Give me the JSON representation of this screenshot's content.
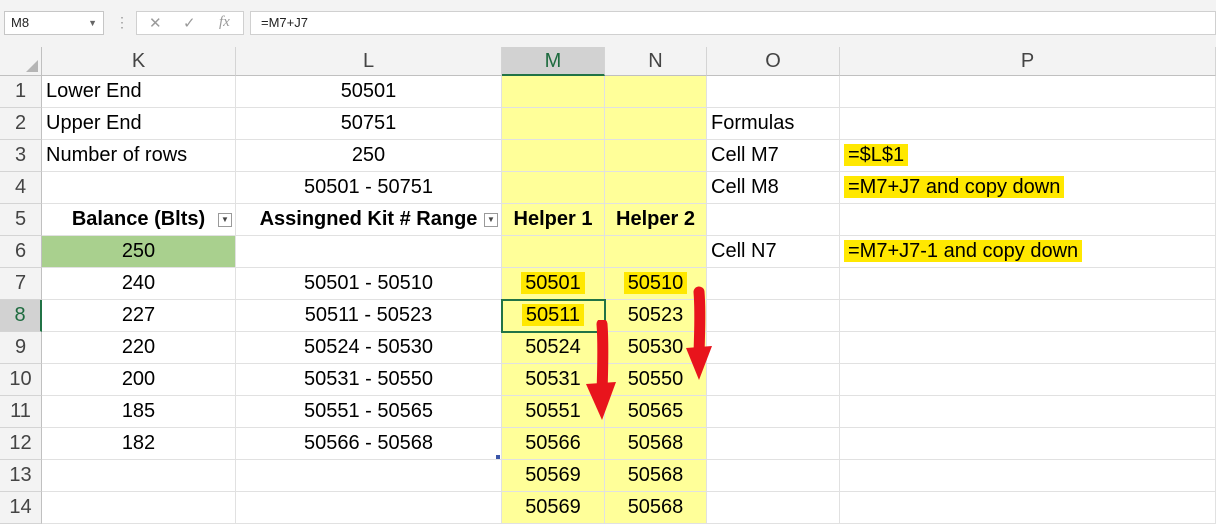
{
  "formula_bar": {
    "name_box": "M8",
    "formula": "=M7+J7",
    "fx_label": "fx"
  },
  "columns": [
    "K",
    "L",
    "M",
    "N",
    "O",
    "P"
  ],
  "rows": [
    "1",
    "2",
    "3",
    "4",
    "5",
    "6",
    "7",
    "8",
    "9",
    "10",
    "11",
    "12",
    "13",
    "14"
  ],
  "cells": {
    "K1": "Lower End",
    "L1": "50501",
    "K2": "Upper End",
    "L2": "50751",
    "O2": "Formulas",
    "K3": "Number of rows",
    "L3": "250",
    "O3": "Cell M7",
    "P3": "=$L$1",
    "L4": "50501 - 50751",
    "O4": "Cell M8",
    "P4": "=M7+J7     and copy down",
    "K5": "Balance (Blts)",
    "L5": "Assingned Kit # Range",
    "M5": "Helper 1",
    "N5": "Helper 2",
    "K6": "250",
    "O6": "Cell N7",
    "P6": "=M7+J7-1      and copy down",
    "K7": "240",
    "L7": "50501 - 50510",
    "M7": "50501",
    "N7": "50510",
    "K8": "227",
    "L8": "50511 - 50523",
    "M8": "50511",
    "N8": "50523",
    "K9": "220",
    "L9": "50524 - 50530",
    "M9": "50524",
    "N9": "50530",
    "K10": "200",
    "L10": "50531 - 50550",
    "M10": "50531",
    "N10": "50550",
    "K11": "185",
    "L11": "50551 - 50565",
    "M11": "50551",
    "N11": "50565",
    "K12": "182",
    "L12": "50566 - 50568",
    "M12": "50566",
    "N12": "50568",
    "M13": "50569",
    "N13": "50568",
    "M14": "50569",
    "N14": "50568"
  },
  "colors": {
    "helper_fill": "#ffff99",
    "highlight": "#ffe800",
    "balance_fill": "#a9d08e",
    "arrow": "#e8141c",
    "selection": "#217346"
  }
}
